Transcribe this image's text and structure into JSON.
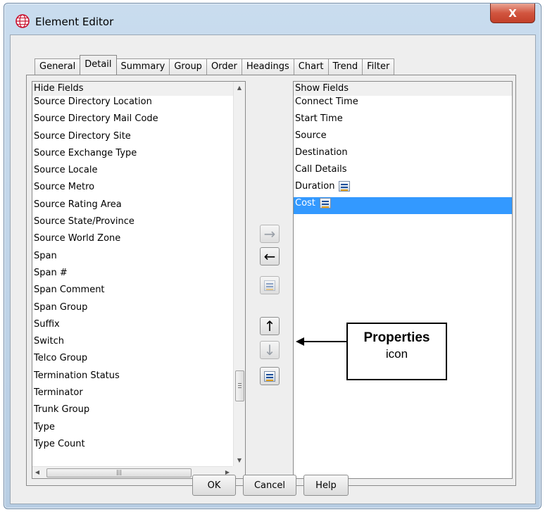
{
  "window": {
    "title": "Element Editor",
    "close_label": "X"
  },
  "tabs": [
    {
      "label": "General"
    },
    {
      "label": "Detail"
    },
    {
      "label": "Summary"
    },
    {
      "label": "Group"
    },
    {
      "label": "Order"
    },
    {
      "label": "Headings"
    },
    {
      "label": "Chart"
    },
    {
      "label": "Trend"
    },
    {
      "label": "Filter"
    }
  ],
  "active_tab": "Detail",
  "hide_fields": {
    "header": "Hide Fields",
    "items": [
      "Source Directory Location",
      "Source Directory Mail Code",
      "Source Directory Site",
      "Source Exchange Type",
      "Source Locale",
      "Source Metro",
      "Source Rating Area",
      "Source State/Province",
      "Source World Zone",
      "Span",
      "Span #",
      "Span Comment",
      "Span Group",
      "Suffix",
      "Switch",
      "Telco Group",
      "Termination Status",
      "Terminator",
      "Trunk Group",
      "Type",
      "Type Count"
    ]
  },
  "show_fields": {
    "header": "Show Fields",
    "items": [
      {
        "label": "Connect Time",
        "has_properties": false,
        "selected": false
      },
      {
        "label": "Start Time",
        "has_properties": false,
        "selected": false
      },
      {
        "label": "Source",
        "has_properties": false,
        "selected": false
      },
      {
        "label": "Destination",
        "has_properties": false,
        "selected": false
      },
      {
        "label": "Call Details",
        "has_properties": false,
        "selected": false
      },
      {
        "label": "Duration",
        "has_properties": true,
        "selected": false
      },
      {
        "label": "Cost",
        "has_properties": true,
        "selected": true
      }
    ]
  },
  "center_buttons": {
    "add": "→",
    "remove": "←",
    "up": "↑",
    "down": "↓"
  },
  "callout": {
    "bold": "Properties",
    "normal": "icon"
  },
  "buttons": {
    "ok": "OK",
    "cancel": "Cancel",
    "help": "Help"
  },
  "colors": {
    "selection": "#3399ff",
    "close_button": "#c2402a"
  }
}
